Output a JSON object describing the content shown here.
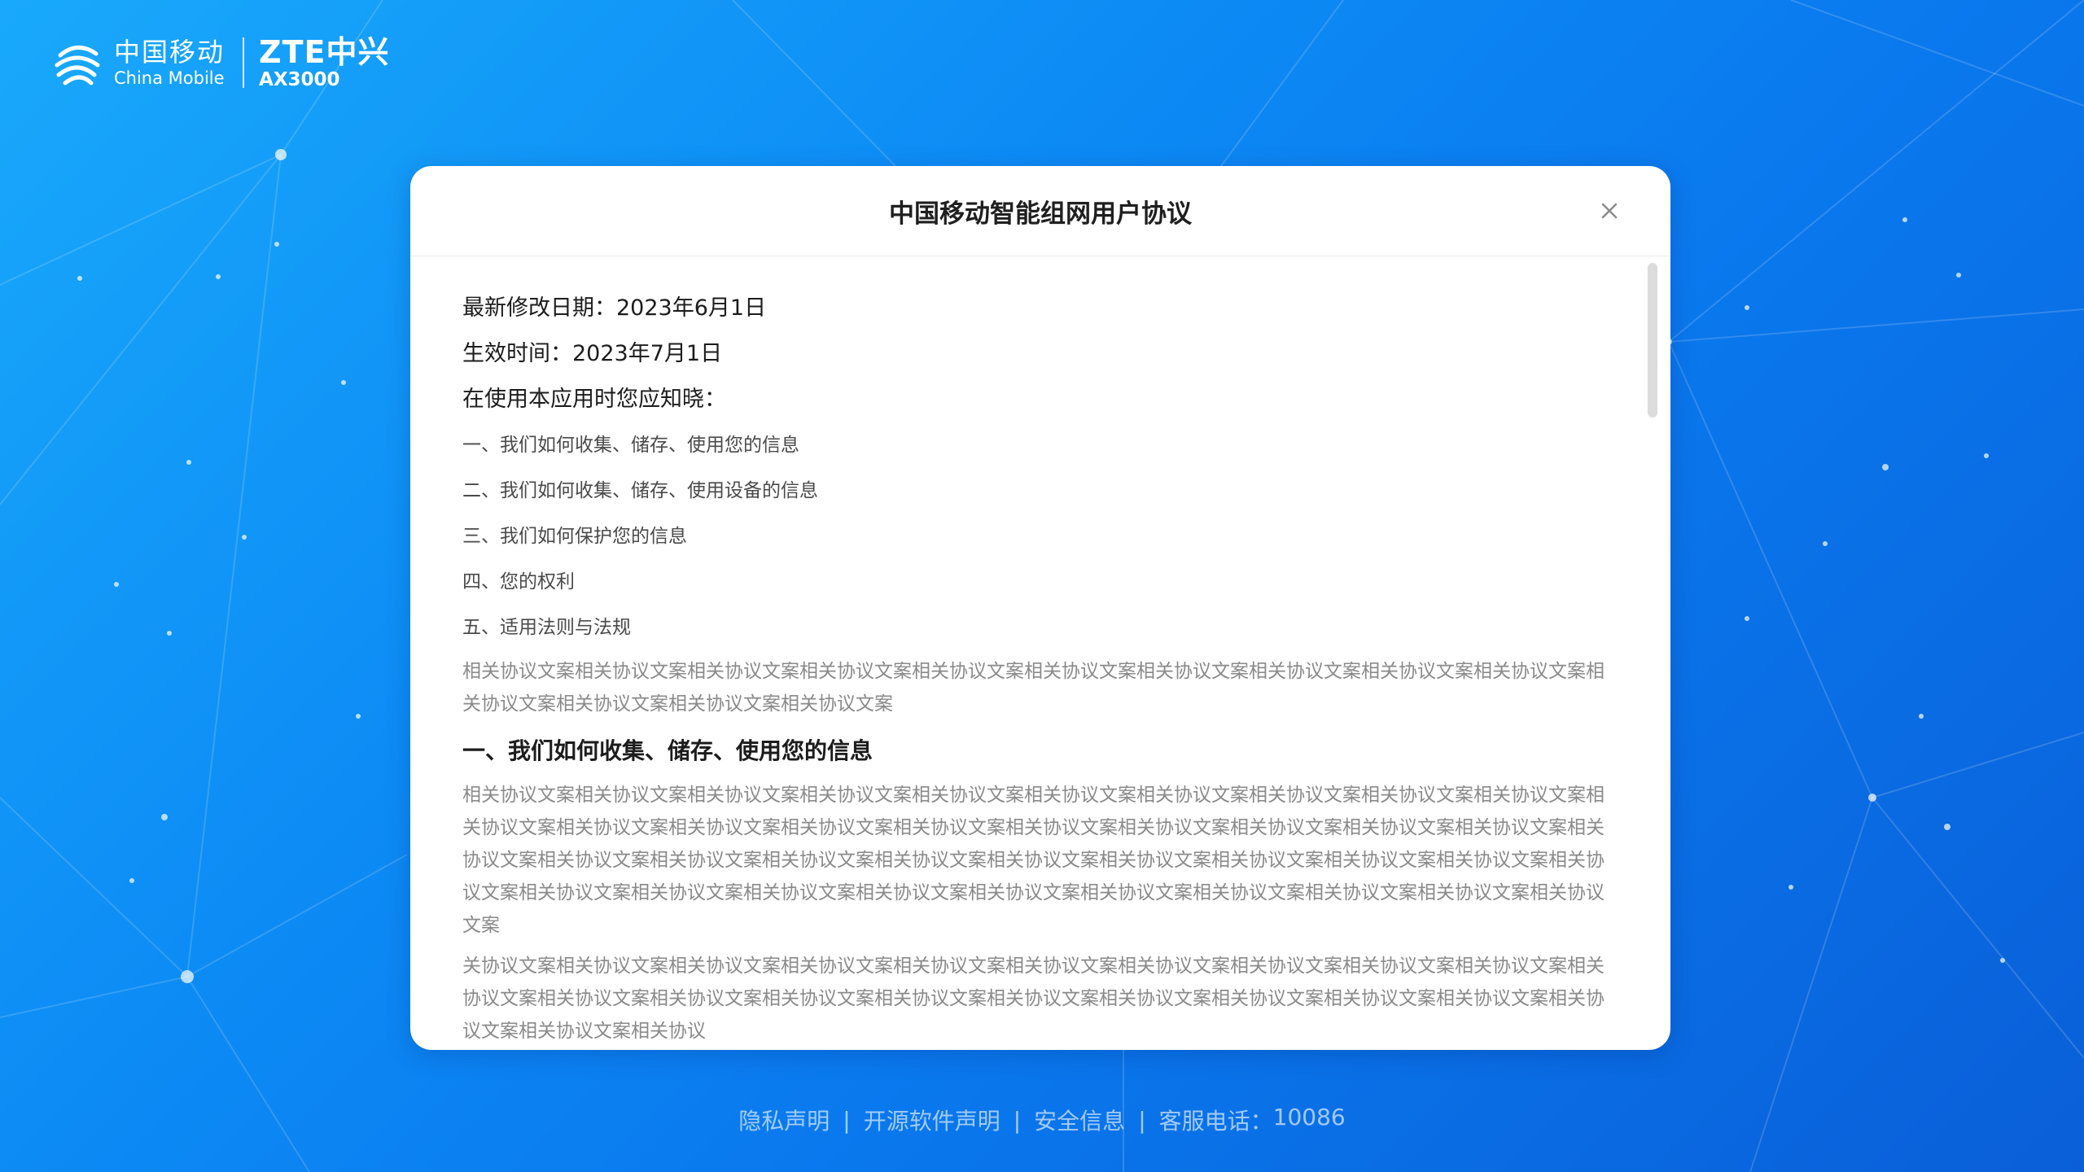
{
  "brand": {
    "china_mobile_cn": "中国移动",
    "china_mobile_en": "China Mobile",
    "zte_brand": "ZTE中兴",
    "model": "AX3000"
  },
  "modal": {
    "title": "中国移动智能组网用户协议",
    "last_modified_label": "最新修改日期：",
    "last_modified_value": "2023年6月1日",
    "effective_label": "生效时间：",
    "effective_value": "2023年7月1日",
    "notice_heading": "在使用本应用时您应知晓：",
    "toc": [
      "一、我们如何收集、储存、使用您的信息",
      "二、我们如何收集、储存、使用设备的信息",
      "三、我们如何保护您的信息",
      "四、您的权利",
      "五、适用法则与法规"
    ],
    "intro_paragraph": "相关协议文案相关协议文案相关协议文案相关协议文案相关协议文案相关协议文案相关协议文案相关协议文案相关协议文案相关协议文案相关协议文案相关协议文案相关协议文案相关协议文案",
    "section1_heading": "一、我们如何收集、储存、使用您的信息",
    "section1_paragraph1": "相关协议文案相关协议文案相关协议文案相关协议文案相关协议文案相关协议文案相关协议文案相关协议文案相关协议文案相关协议文案相关协议文案相关协议文案相关协议文案相关协议文案相关协议文案相关协议文案相关协议文案相关协议文案相关协议文案相关协议文案相关协议文案相关协议文案相关协议文案相关协议文案相关协议文案相关协议文案相关协议文案相关协议文案相关协议文案相关协议文案相关协议文案相关协议文案相关协议文案相关协议文案相关协议文案相关协议文案相关协议文案相关协议文案相关协议文案相关协议文案相关协议文案",
    "section1_paragraph2": "关协议文案相关协议文案相关协议文案相关协议文案相关协议文案相关协议文案相关协议文案相关协议文案相关协议文案相关协议文案相关协议文案相关协议文案相关协议文案相关协议文案相关协议文案相关协议文案相关协议文案相关协议文案相关协议文案相关协议文案相关协议文案相关协议文案相关协议"
  },
  "footer": {
    "privacy": "隐私声明",
    "open_source": "开源软件声明",
    "security": "安全信息",
    "service_label": "客服电话：",
    "service_phone": "10086",
    "separator": "|"
  }
}
